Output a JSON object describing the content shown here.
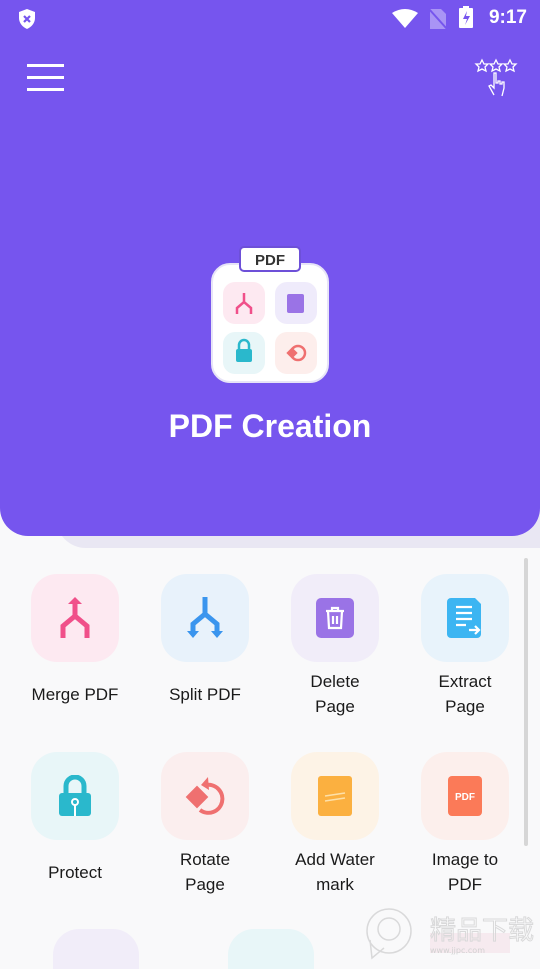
{
  "status_bar": {
    "time": "9:17",
    "icons": [
      "shield-x-icon",
      "wifi-icon",
      "no-sim-icon",
      "battery-charging-icon"
    ]
  },
  "header": {
    "title": "PDF Creation",
    "logo_label": "PDF",
    "menu_icon": "hamburger-menu-icon",
    "rate_icon": "rate-stars-hand-icon",
    "color": "#7655ee"
  },
  "tools": [
    {
      "label": "Merge PDF",
      "icon": "merge-icon",
      "bg": "#fde9f1",
      "fg": "#f0508a"
    },
    {
      "label": "Split PDF",
      "icon": "split-icon",
      "bg": "#e8f2fb",
      "fg": "#3a95ee"
    },
    {
      "label": "Delete\nPage",
      "icon": "trash-icon",
      "bg": "#f1edf9",
      "fg": "#9a73e6"
    },
    {
      "label": "Extract\nPage",
      "icon": "extract-page-icon",
      "bg": "#e8f3fb",
      "fg": "#3cb5f2"
    },
    {
      "label": "Protect",
      "icon": "lock-icon",
      "bg": "#e8f6f8",
      "fg": "#2ab8cc"
    },
    {
      "label": "Rotate\nPage",
      "icon": "rotate-icon",
      "bg": "#fbeeee",
      "fg": "#ef7070"
    },
    {
      "label": "Add Water\nmark",
      "icon": "watermark-icon",
      "bg": "#fdf3e6",
      "fg": "#fbb040"
    },
    {
      "label": "Image to\nPDF",
      "icon": "image-to-pdf-icon",
      "bg": "#fcefec",
      "fg": "#fb7a58"
    }
  ],
  "watermark": {
    "text": "精品下载",
    "url": "www.jjpc.com"
  }
}
